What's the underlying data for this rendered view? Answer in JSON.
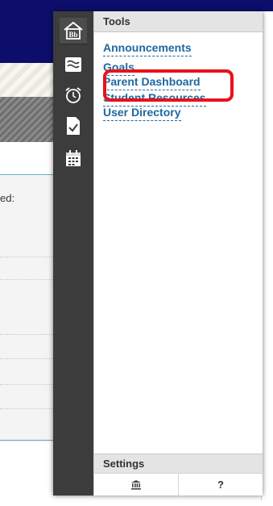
{
  "menu": {
    "tools_title": "Tools",
    "tools": [
      {
        "label": "Announcements"
      },
      {
        "label": "Goals"
      },
      {
        "label": "Parent Dashboard"
      },
      {
        "label": "Student Resources"
      },
      {
        "label": "User Directory"
      }
    ],
    "settings_title": "Settings",
    "footer": {
      "home_icon": "institution-icon",
      "help_glyph": "?"
    },
    "rail_icons": [
      "blackboard-home-icon",
      "activity-stream-icon",
      "alarm-clock-icon",
      "grades-check-icon",
      "calendar-icon"
    ],
    "rail_logo_text": "Bb"
  },
  "background": {
    "partial_label": "ed:"
  },
  "colors": {
    "header_navy": "#0d0d6b",
    "rail": "#3c3c3c",
    "link": "#1f68a0",
    "highlight": "#e8121b",
    "section_header": "#e4e4e4"
  }
}
